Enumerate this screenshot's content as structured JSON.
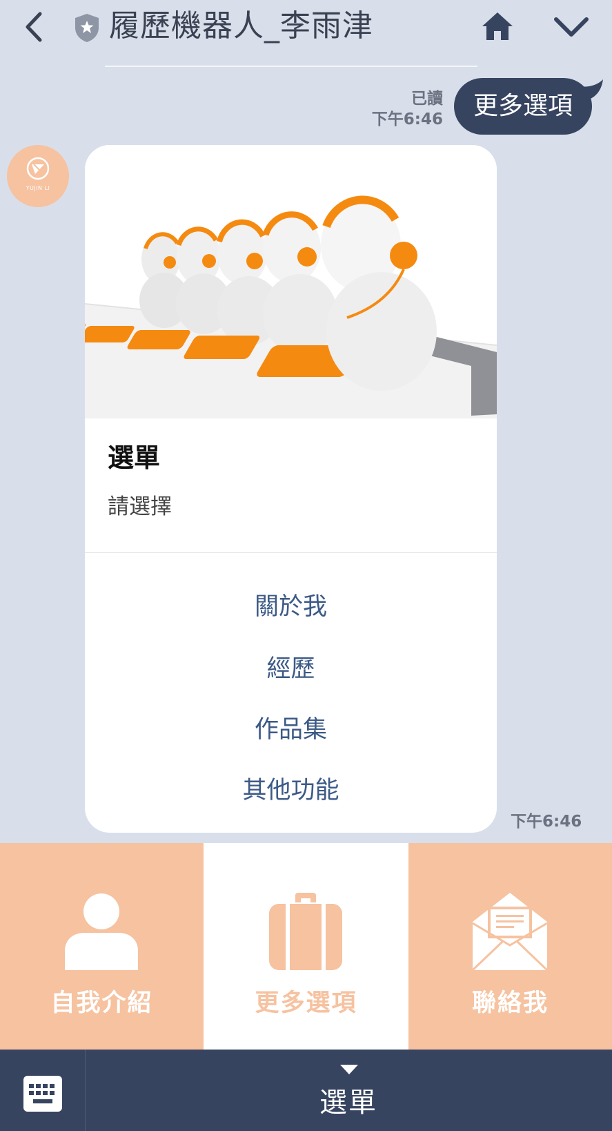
{
  "header": {
    "title": "履歷機器人_李雨津"
  },
  "outgoing": {
    "read_label": "已讀",
    "time": "下午6:46",
    "text": "更多選項"
  },
  "avatar": {
    "text": "YUJIN LI"
  },
  "card": {
    "title": "選單",
    "subtitle": "請選擇",
    "options": [
      "關於我",
      "經歷",
      "作品集",
      "其他功能"
    ],
    "time": "下午6:46"
  },
  "rich_menu": {
    "items": [
      {
        "label": "自我介紹",
        "icon": "person-icon"
      },
      {
        "label": "更多選項",
        "icon": "briefcase-icon"
      },
      {
        "label": "聯絡我",
        "icon": "envelope-icon"
      }
    ]
  },
  "bottom_bar": {
    "menu_label": "選單"
  },
  "colors": {
    "background": "#d8dfea",
    "navy": "#374460",
    "peach": "#f6c2a0",
    "link": "#3c5a86"
  }
}
